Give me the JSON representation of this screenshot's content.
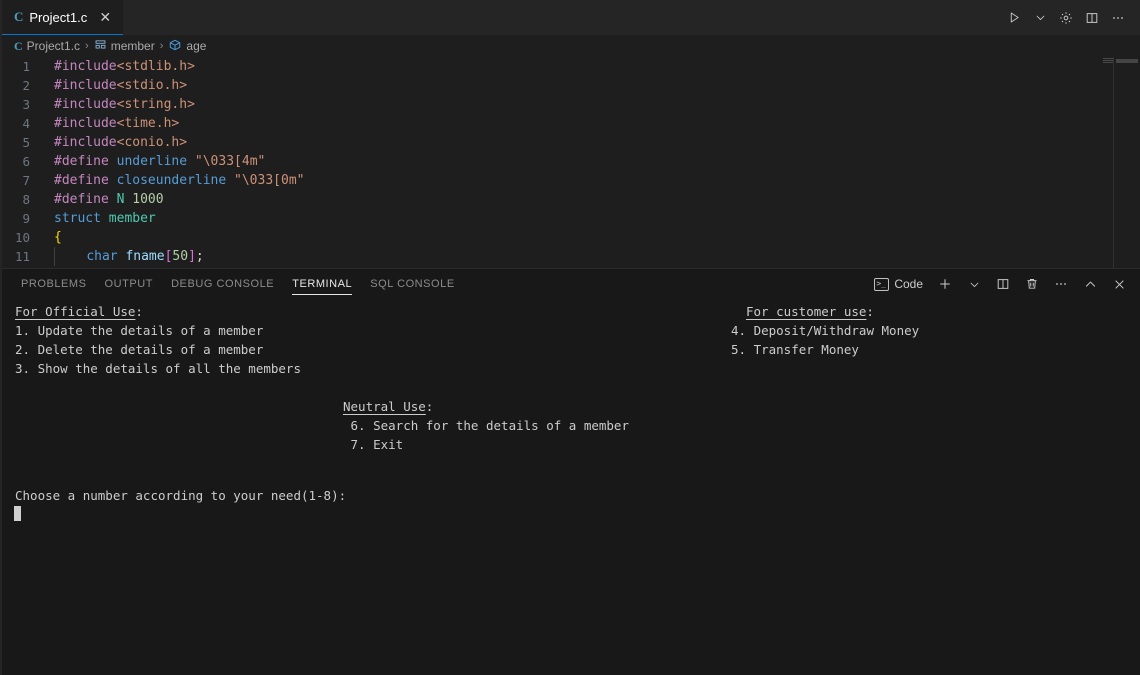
{
  "window": {
    "tab": {
      "lang_icon": "C",
      "label": "Project1.c",
      "close_icon": "✕"
    },
    "editor_actions": [
      {
        "name": "run-button",
        "glyph": "▷"
      },
      {
        "name": "chevron-down-icon",
        "glyph": "⌄"
      },
      {
        "name": "settings-gear-icon",
        "glyph": "⚙"
      },
      {
        "name": "split-editor-icon",
        "glyph": "▫"
      },
      {
        "name": "more-actions-icon",
        "glyph": "⋯"
      }
    ]
  },
  "breadcrumb": {
    "file_icon": "C",
    "file": "Project1.c",
    "sep": "›",
    "struct_label": "member",
    "field_label": "age"
  },
  "editor": {
    "lines": [
      {
        "n": "1",
        "tokens": [
          {
            "t": "#include",
            "c": "t-pre"
          },
          {
            "t": "<stdlib.h>",
            "c": "t-inc"
          }
        ]
      },
      {
        "n": "2",
        "tokens": [
          {
            "t": "#include",
            "c": "t-pre"
          },
          {
            "t": "<stdio.h>",
            "c": "t-inc"
          }
        ]
      },
      {
        "n": "3",
        "tokens": [
          {
            "t": "#include",
            "c": "t-pre"
          },
          {
            "t": "<string.h>",
            "c": "t-inc"
          }
        ]
      },
      {
        "n": "4",
        "tokens": [
          {
            "t": "#include",
            "c": "t-pre"
          },
          {
            "t": "<time.h>",
            "c": "t-inc"
          }
        ]
      },
      {
        "n": "5",
        "tokens": [
          {
            "t": "#include",
            "c": "t-pre"
          },
          {
            "t": "<conio.h>",
            "c": "t-inc"
          }
        ]
      },
      {
        "n": "6",
        "tokens": [
          {
            "t": "#define ",
            "c": "t-pre"
          },
          {
            "t": "underline",
            "c": "t-macro"
          },
          {
            "t": " ",
            "c": "t-plain"
          },
          {
            "t": "\"\\033[4m\"",
            "c": "t-str"
          }
        ]
      },
      {
        "n": "7",
        "tokens": [
          {
            "t": "#define ",
            "c": "t-pre"
          },
          {
            "t": "closeunderline",
            "c": "t-macro"
          },
          {
            "t": " ",
            "c": "t-plain"
          },
          {
            "t": "\"\\033[0m\"",
            "c": "t-str"
          }
        ]
      },
      {
        "n": "8",
        "tokens": [
          {
            "t": "#define ",
            "c": "t-pre"
          },
          {
            "t": "N",
            "c": "t-type"
          },
          {
            "t": " ",
            "c": "t-plain"
          },
          {
            "t": "1000",
            "c": "t-num"
          }
        ]
      },
      {
        "n": "9",
        "tokens": [
          {
            "t": "struct",
            "c": "t-kw"
          },
          {
            "t": " ",
            "c": "t-plain"
          },
          {
            "t": "member",
            "c": "t-type"
          }
        ]
      },
      {
        "n": "10",
        "tokens": [
          {
            "t": "{",
            "c": "t-brace-y"
          }
        ]
      },
      {
        "n": "11",
        "tokens": [
          {
            "t": "    ",
            "c": "t-plain"
          },
          {
            "t": "char",
            "c": "t-kw"
          },
          {
            "t": " ",
            "c": "t-plain"
          },
          {
            "t": "fname",
            "c": "t-var"
          },
          {
            "t": "[",
            "c": "t-brace-m"
          },
          {
            "t": "50",
            "c": "t-num"
          },
          {
            "t": "]",
            "c": "t-brace-m"
          },
          {
            "t": ";",
            "c": "t-plain"
          }
        ]
      }
    ]
  },
  "panel": {
    "tabs": [
      {
        "label": "PROBLEMS",
        "active": false
      },
      {
        "label": "OUTPUT",
        "active": false
      },
      {
        "label": "DEBUG CONSOLE",
        "active": false
      },
      {
        "label": "TERMINAL",
        "active": true
      },
      {
        "label": "SQL CONSOLE",
        "active": false
      }
    ],
    "terminal_selector": {
      "icon": "❯",
      "label": "Code"
    },
    "actions": [
      {
        "name": "new-terminal-icon",
        "glyph": "＋"
      },
      {
        "name": "chevron-down-icon",
        "glyph": "⌄"
      },
      {
        "name": "split-terminal-icon",
        "glyph": "▫"
      },
      {
        "name": "kill-terminal-icon",
        "glyph": "🗑"
      },
      {
        "name": "more-actions-icon",
        "glyph": "⋯"
      },
      {
        "name": "maximize-panel-icon",
        "glyph": "⌃"
      },
      {
        "name": "close-panel-icon",
        "glyph": "✕"
      }
    ]
  },
  "terminal": {
    "official_heading": "For Official Use",
    "official_items": [
      "1. Update the details of a member",
      "2. Delete the details of a member",
      "3. Show the details of all the members"
    ],
    "customer_heading": "For customer use",
    "customer_items": [
      "4. Deposit/Withdraw Money",
      "5. Transfer Money"
    ],
    "neutral_heading": "Neutral Use",
    "neutral_items": [
      " 6. Search for the details of a member",
      " 7. Exit"
    ],
    "colon": ":",
    "prompt": "Choose a number according to your need(1-8):"
  },
  "colors": {
    "editor_bg": "#1e1e1e",
    "panel_bg": "#181818",
    "tabbar_bg": "#252526",
    "accent": "#0078d4",
    "terminal_fg": "#cccccc"
  }
}
